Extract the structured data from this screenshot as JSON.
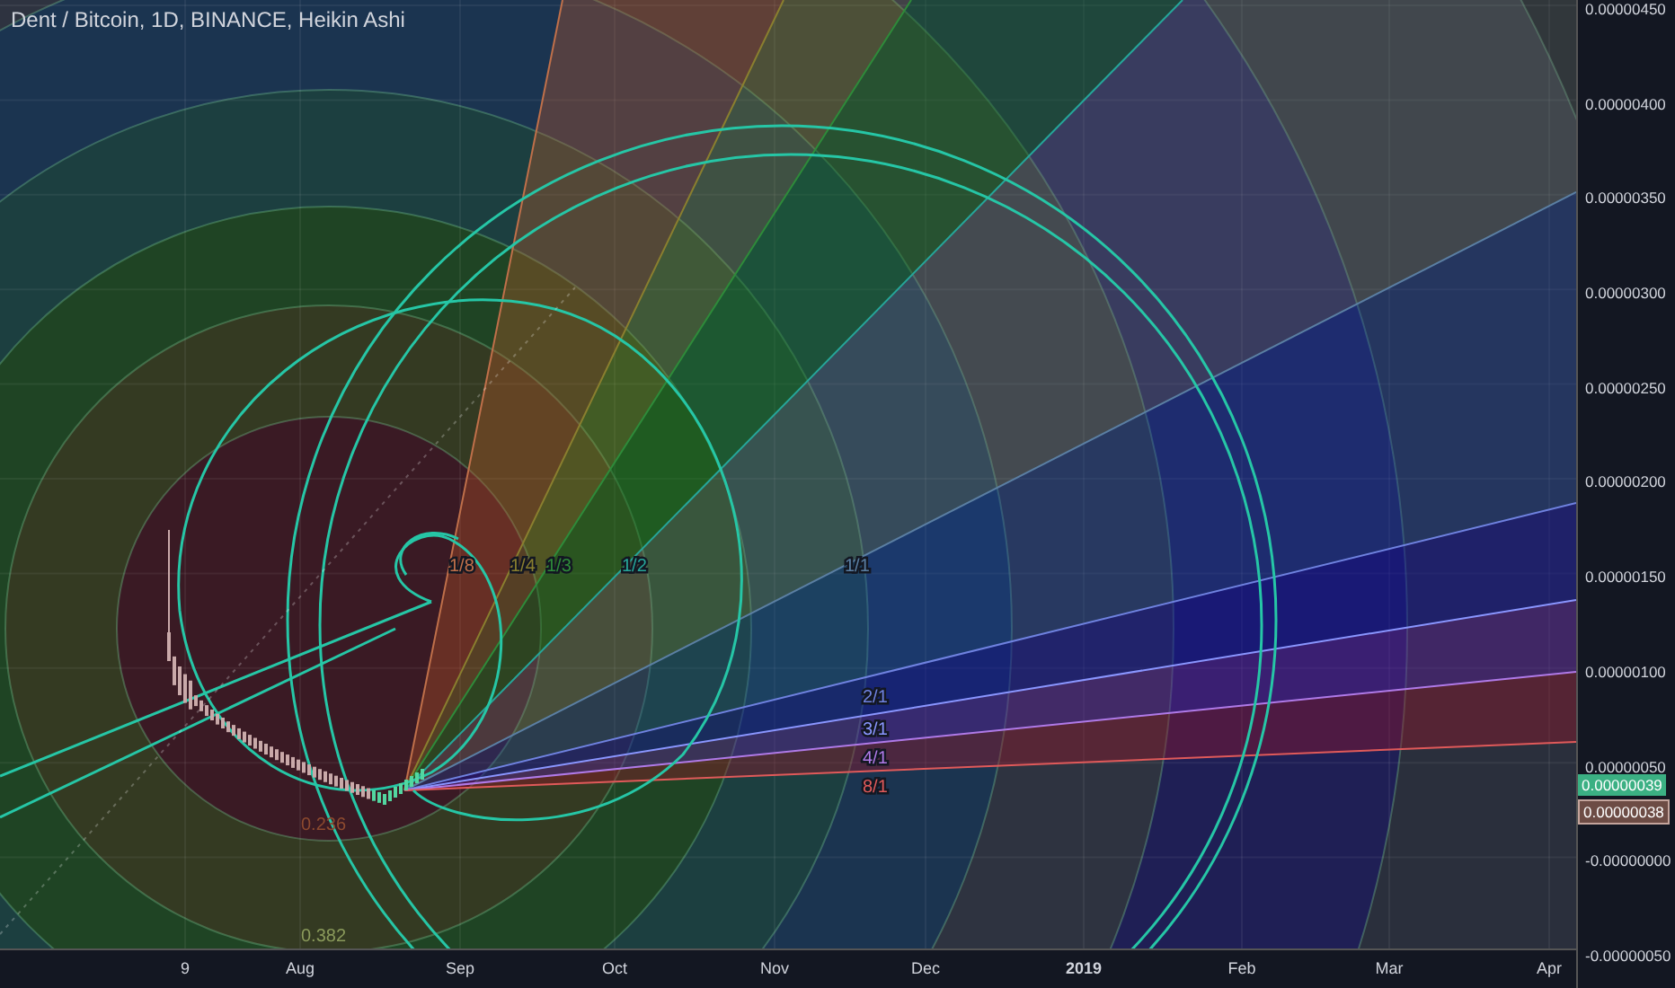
{
  "chart": {
    "title": "Dent / Bitcoin, 1D, BINANCE, Heikin Ashi",
    "fan_labels": [
      {
        "text": "1/8",
        "color": "#c0704a"
      },
      {
        "text": "1/4",
        "color": "#8a7f2f"
      },
      {
        "text": "1/3",
        "color": "#2e8b3a"
      },
      {
        "text": "1/2",
        "color": "#26a69a"
      },
      {
        "text": "1/1",
        "color": "#5b7fa3"
      },
      {
        "text": "2/1",
        "color": "#6f82e0"
      },
      {
        "text": "3/1",
        "color": "#8a96ff"
      },
      {
        "text": "4/1",
        "color": "#b07ae8"
      },
      {
        "text": "8/1",
        "color": "#e05a5a"
      }
    ],
    "circle_labels": [
      {
        "text": "0.236",
        "color": "#8d4a2f"
      },
      {
        "text": "0.382",
        "color": "#8a9a5b"
      }
    ]
  },
  "price_axis": {
    "ticks": [
      "0.00000450",
      "0.00000400",
      "0.00000350",
      "0.00000300",
      "0.00000250",
      "0.00000200",
      "0.00000150",
      "0.00000100",
      "0.00000050",
      "-0.00000000",
      "-0.00000050"
    ],
    "last_price": "0.00000039",
    "prev_close": "0.00000038"
  },
  "time_axis": {
    "ticks": [
      {
        "label": "9",
        "bold": false
      },
      {
        "label": "Aug",
        "bold": false
      },
      {
        "label": "Sep",
        "bold": false
      },
      {
        "label": "Oct",
        "bold": false
      },
      {
        "label": "Nov",
        "bold": false
      },
      {
        "label": "Dec",
        "bold": false
      },
      {
        "label": "2019",
        "bold": true
      },
      {
        "label": "Feb",
        "bold": false
      },
      {
        "label": "Mar",
        "bold": false
      },
      {
        "label": "Apr",
        "bold": false
      }
    ]
  }
}
